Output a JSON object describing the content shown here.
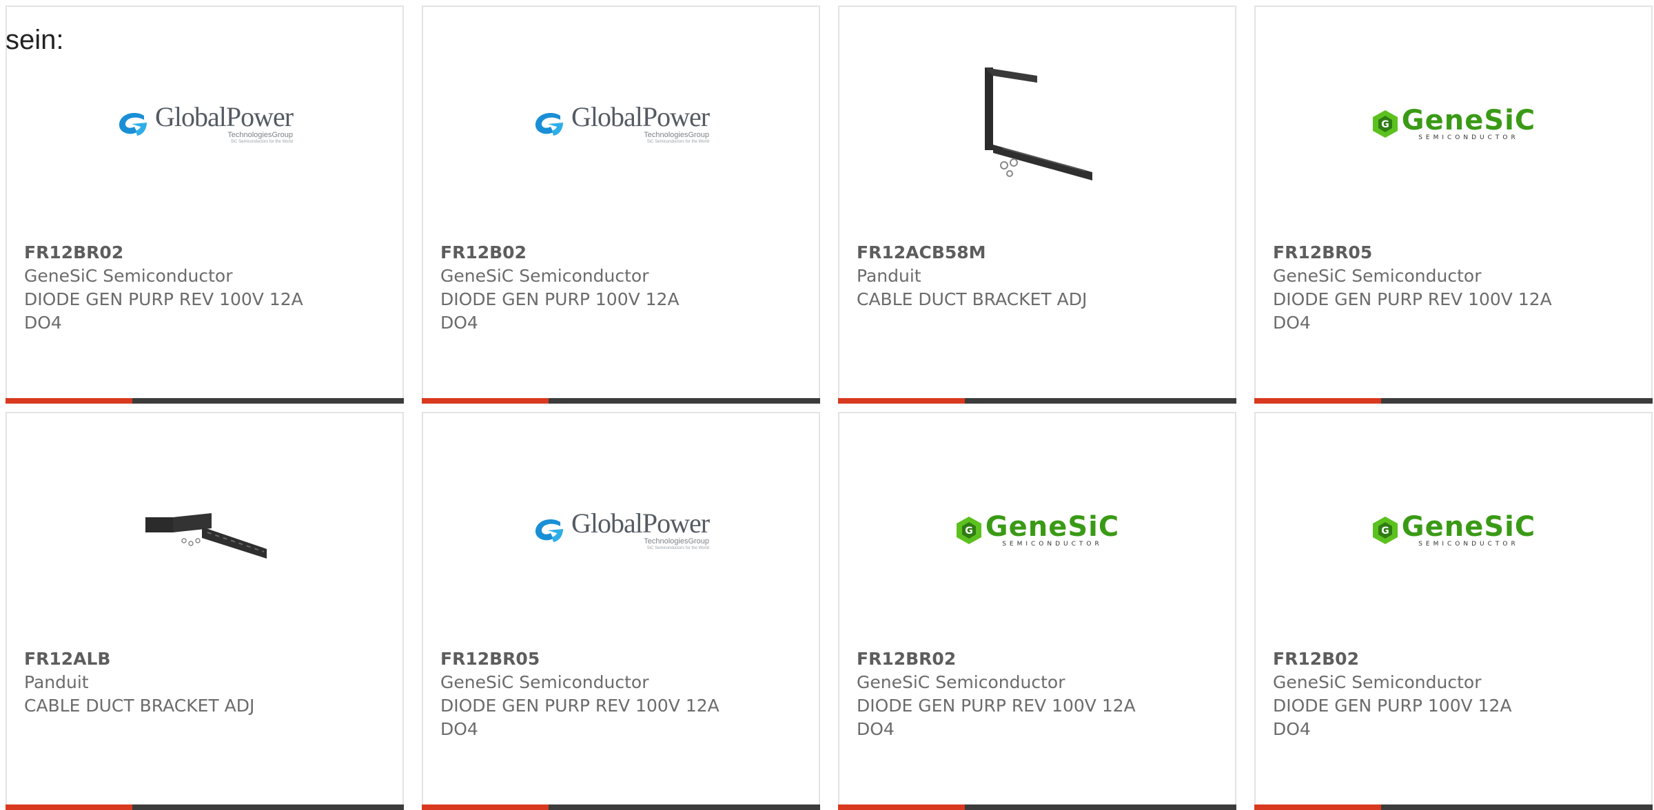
{
  "caption": "sein:",
  "colors": {
    "accent": "#d8391f",
    "bar": "#3c3c3c",
    "text": "#6b6b6b",
    "genesic_green": "#3a9a16"
  },
  "logos": {
    "globalpower": {
      "name": "GlobalPower",
      "sub": "TechnologiesGroup",
      "tag": "SiC Semiconductors for the World"
    },
    "genesic": {
      "name": "GeneSiC",
      "sub": "SEMICONDUCTOR"
    }
  },
  "products": [
    {
      "part_number": "FR12BR02",
      "manufacturer": "GeneSiC Semiconductor",
      "description": "DIODE GEN PURP REV 100V 12A DO4",
      "image": "globalpower-logo"
    },
    {
      "part_number": "FR12B02",
      "manufacturer": "GeneSiC Semiconductor",
      "description": "DIODE GEN PURP 100V 12A DO4",
      "image": "globalpower-logo"
    },
    {
      "part_number": "FR12ACB58M",
      "manufacturer": "Panduit",
      "description": "CABLE DUCT BRACKET ADJ",
      "image": "bracket-photo"
    },
    {
      "part_number": "FR12BR05",
      "manufacturer": "GeneSiC Semiconductor",
      "description": "DIODE GEN PURP REV 100V 12A DO4",
      "image": "genesic-logo"
    },
    {
      "part_number": "FR12ALB",
      "manufacturer": "Panduit",
      "description": "CABLE DUCT BRACKET ADJ",
      "image": "bracket-photo"
    },
    {
      "part_number": "FR12BR05",
      "manufacturer": "GeneSiC Semiconductor",
      "description": "DIODE GEN PURP REV 100V 12A DO4",
      "image": "globalpower-logo"
    },
    {
      "part_number": "FR12BR02",
      "manufacturer": "GeneSiC Semiconductor",
      "description": "DIODE GEN PURP REV 100V 12A DO4",
      "image": "genesic-logo"
    },
    {
      "part_number": "FR12B02",
      "manufacturer": "GeneSiC Semiconductor",
      "description": "DIODE GEN PURP 100V 12A DO4",
      "image": "genesic-logo"
    }
  ]
}
